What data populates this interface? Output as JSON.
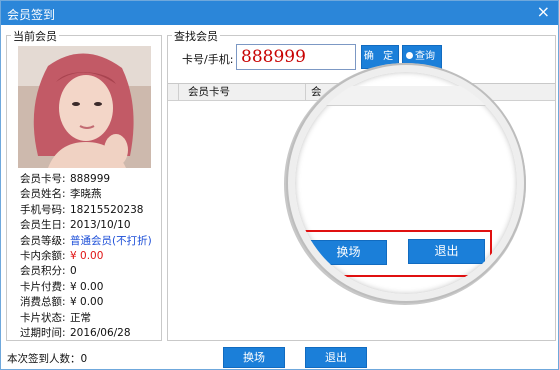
{
  "window": {
    "title": "会员签到",
    "close_glyph": "×"
  },
  "member_panel": {
    "legend": "当前会员",
    "photo_alt": "member photo",
    "fields": [
      {
        "label": "会员卡号:",
        "value": "888999"
      },
      {
        "label": "会员姓名:",
        "value": "李晓燕"
      },
      {
        "label": "手机号码:",
        "value": "18215520238"
      },
      {
        "label": "会员生日:",
        "value": "2013/10/10"
      },
      {
        "label": "会员等级:",
        "value": "普通会员(不打折)",
        "color": "#1d4fd8"
      },
      {
        "label": "卡内余额:",
        "value": "¥ 0.00",
        "color": "#e01515"
      },
      {
        "label": "会员积分:",
        "value": "0"
      },
      {
        "label": "卡片付费:",
        "value": "¥ 0.00"
      },
      {
        "label": "消费总额:",
        "value": "¥ 0.00"
      },
      {
        "label": "卡片状态:",
        "value": "正常"
      },
      {
        "label": "过期时间:",
        "value": "2016/06/28"
      }
    ]
  },
  "search_panel": {
    "legend": "查找会员",
    "label": "卡号/手机:",
    "input_value": "888999",
    "confirm_label": "确 定",
    "query_label": "查询",
    "query_icon": "search-icon",
    "grid_columns": [
      "会员卡号",
      "会"
    ]
  },
  "footer": {
    "status_text": "本次签到人数：0",
    "switch_label": "换场",
    "exit_label": "退出"
  },
  "magnifier": {
    "switch_label": "换场",
    "exit_label": "退出",
    "highlight_color": "#e01010"
  },
  "colors": {
    "titlebar": "#2b86d9",
    "button": "#1b7fd9",
    "input_text": "#c80000"
  }
}
